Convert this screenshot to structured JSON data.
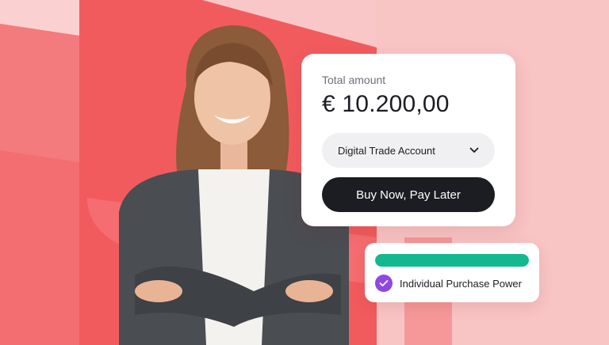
{
  "colors": {
    "background": "#f9c7c7",
    "accent_red": "#f25b5e",
    "progress_green": "#14b88f",
    "check_purple": "#8e49e0",
    "button_dark": "#1c1d22"
  },
  "amount_card": {
    "label": "Total amount",
    "amount": "€ 10.200,00",
    "select": {
      "value": "Digital Trade Account",
      "icon": "chevron-down-icon"
    },
    "cta_label": "Buy Now, Pay Later"
  },
  "purchase_power": {
    "progress": 1.0,
    "icon": "check-icon",
    "label": "Individual Purchase Power"
  }
}
